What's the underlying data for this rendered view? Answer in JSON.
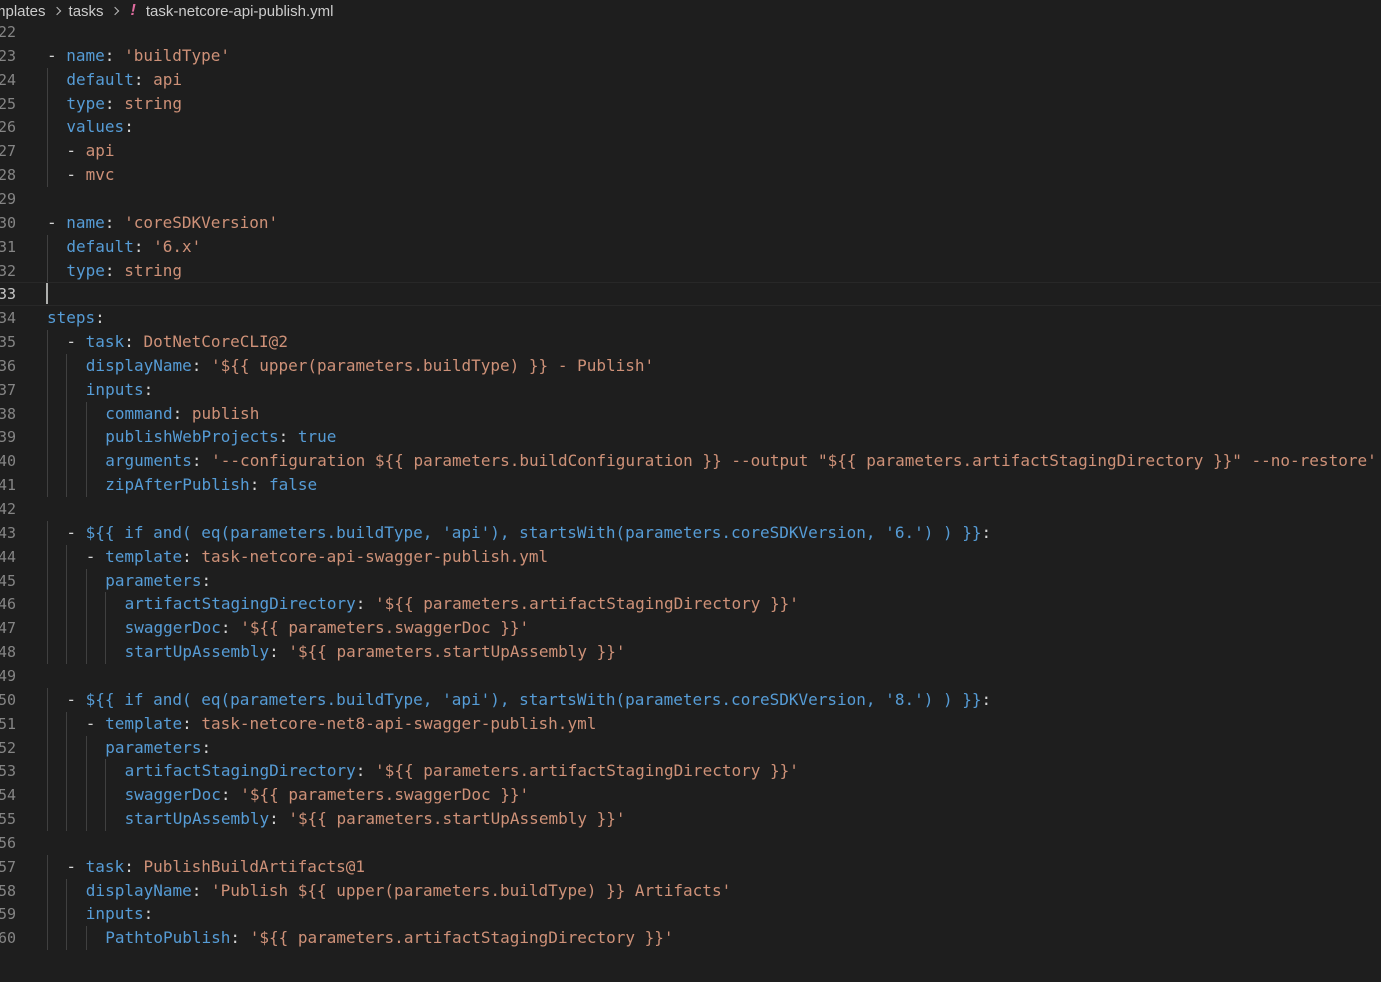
{
  "breadcrumb": {
    "parts": [
      "mplates",
      "tasks",
      "task-netcore-api-publish.yml"
    ],
    "file_icon": "!"
  },
  "editor": {
    "current_line": 33,
    "lines": [
      {
        "n": "22",
        "indent": 0,
        "tokens": []
      },
      {
        "n": "23",
        "indent": 0,
        "tokens": [
          [
            "p",
            "- "
          ],
          [
            "k",
            "name"
          ],
          [
            "p",
            ": "
          ],
          [
            "s",
            "'buildType'"
          ]
        ]
      },
      {
        "n": "24",
        "indent": 1,
        "tokens": [
          [
            "k",
            "default"
          ],
          [
            "p",
            ": "
          ],
          [
            "s",
            "api"
          ]
        ]
      },
      {
        "n": "25",
        "indent": 1,
        "tokens": [
          [
            "k",
            "type"
          ],
          [
            "p",
            ": "
          ],
          [
            "s",
            "string"
          ]
        ]
      },
      {
        "n": "26",
        "indent": 1,
        "tokens": [
          [
            "k",
            "values"
          ],
          [
            "p",
            ":"
          ]
        ]
      },
      {
        "n": "27",
        "indent": 1,
        "tokens": [
          [
            "p",
            "- "
          ],
          [
            "s",
            "api"
          ]
        ]
      },
      {
        "n": "28",
        "indent": 1,
        "tokens": [
          [
            "p",
            "- "
          ],
          [
            "s",
            "mvc"
          ]
        ]
      },
      {
        "n": "29",
        "indent": 0,
        "tokens": []
      },
      {
        "n": "30",
        "indent": 0,
        "tokens": [
          [
            "p",
            "- "
          ],
          [
            "k",
            "name"
          ],
          [
            "p",
            ": "
          ],
          [
            "s",
            "'coreSDKVersion'"
          ]
        ]
      },
      {
        "n": "31",
        "indent": 1,
        "tokens": [
          [
            "k",
            "default"
          ],
          [
            "p",
            ": "
          ],
          [
            "s",
            "'6.x'"
          ]
        ]
      },
      {
        "n": "32",
        "indent": 1,
        "tokens": [
          [
            "k",
            "type"
          ],
          [
            "p",
            ": "
          ],
          [
            "s",
            "string"
          ]
        ]
      },
      {
        "n": "33",
        "indent": 0,
        "tokens": []
      },
      {
        "n": "34",
        "indent": 0,
        "tokens": [
          [
            "k",
            "steps"
          ],
          [
            "p",
            ":"
          ]
        ]
      },
      {
        "n": "35",
        "indent": 1,
        "tokens": [
          [
            "p",
            "- "
          ],
          [
            "k",
            "task"
          ],
          [
            "p",
            ": "
          ],
          [
            "s",
            "DotNetCoreCLI@2"
          ]
        ]
      },
      {
        "n": "36",
        "indent": 2,
        "tokens": [
          [
            "k",
            "displayName"
          ],
          [
            "p",
            ": "
          ],
          [
            "s",
            "'${{ upper(parameters.buildType) }} - Publish'"
          ]
        ]
      },
      {
        "n": "37",
        "indent": 2,
        "tokens": [
          [
            "k",
            "inputs"
          ],
          [
            "p",
            ":"
          ]
        ]
      },
      {
        "n": "38",
        "indent": 3,
        "tokens": [
          [
            "k",
            "command"
          ],
          [
            "p",
            ": "
          ],
          [
            "s",
            "publish"
          ]
        ]
      },
      {
        "n": "39",
        "indent": 3,
        "tokens": [
          [
            "k",
            "publishWebProjects"
          ],
          [
            "p",
            ": "
          ],
          [
            "k",
            "true"
          ]
        ]
      },
      {
        "n": "40",
        "indent": 3,
        "tokens": [
          [
            "k",
            "arguments"
          ],
          [
            "p",
            ": "
          ],
          [
            "s",
            "'--configuration ${{ parameters.buildConfiguration }} --output \"${{ parameters.artifactStagingDirectory }}\" --no-restore'"
          ]
        ]
      },
      {
        "n": "41",
        "indent": 3,
        "tokens": [
          [
            "k",
            "zipAfterPublish"
          ],
          [
            "p",
            ": "
          ],
          [
            "k",
            "false"
          ]
        ]
      },
      {
        "n": "42",
        "indent": 0,
        "tokens": []
      },
      {
        "n": "43",
        "indent": 1,
        "tokens": [
          [
            "p",
            "- "
          ],
          [
            "k",
            "${{ if and( eq(parameters.buildType, 'api'), startsWith(parameters.coreSDKVersion, '6.') ) }}"
          ],
          [
            "p",
            ":"
          ]
        ]
      },
      {
        "n": "44",
        "indent": 2,
        "tokens": [
          [
            "p",
            "- "
          ],
          [
            "k",
            "template"
          ],
          [
            "p",
            ": "
          ],
          [
            "s",
            "task-netcore-api-swagger-publish.yml"
          ]
        ]
      },
      {
        "n": "45",
        "indent": 3,
        "tokens": [
          [
            "k",
            "parameters"
          ],
          [
            "p",
            ":"
          ]
        ]
      },
      {
        "n": "46",
        "indent": 4,
        "tokens": [
          [
            "k",
            "artifactStagingDirectory"
          ],
          [
            "p",
            ": "
          ],
          [
            "s",
            "'${{ parameters.artifactStagingDirectory }}'"
          ]
        ]
      },
      {
        "n": "47",
        "indent": 4,
        "tokens": [
          [
            "k",
            "swaggerDoc"
          ],
          [
            "p",
            ": "
          ],
          [
            "s",
            "'${{ parameters.swaggerDoc }}'"
          ]
        ]
      },
      {
        "n": "48",
        "indent": 4,
        "tokens": [
          [
            "k",
            "startUpAssembly"
          ],
          [
            "p",
            ": "
          ],
          [
            "s",
            "'${{ parameters.startUpAssembly }}'"
          ]
        ]
      },
      {
        "n": "49",
        "indent": 0,
        "tokens": []
      },
      {
        "n": "50",
        "indent": 1,
        "tokens": [
          [
            "p",
            "- "
          ],
          [
            "k",
            "${{ if and( eq(parameters.buildType, 'api'), startsWith(parameters.coreSDKVersion, '8.') ) }}"
          ],
          [
            "p",
            ":"
          ]
        ]
      },
      {
        "n": "51",
        "indent": 2,
        "tokens": [
          [
            "p",
            "- "
          ],
          [
            "k",
            "template"
          ],
          [
            "p",
            ": "
          ],
          [
            "s",
            "task-netcore-net8-api-swagger-publish.yml"
          ]
        ]
      },
      {
        "n": "52",
        "indent": 3,
        "tokens": [
          [
            "k",
            "parameters"
          ],
          [
            "p",
            ":"
          ]
        ]
      },
      {
        "n": "53",
        "indent": 4,
        "tokens": [
          [
            "k",
            "artifactStagingDirectory"
          ],
          [
            "p",
            ": "
          ],
          [
            "s",
            "'${{ parameters.artifactStagingDirectory }}'"
          ]
        ]
      },
      {
        "n": "54",
        "indent": 4,
        "tokens": [
          [
            "k",
            "swaggerDoc"
          ],
          [
            "p",
            ": "
          ],
          [
            "s",
            "'${{ parameters.swaggerDoc }}'"
          ]
        ]
      },
      {
        "n": "55",
        "indent": 4,
        "tokens": [
          [
            "k",
            "startUpAssembly"
          ],
          [
            "p",
            ": "
          ],
          [
            "s",
            "'${{ parameters.startUpAssembly }}'"
          ]
        ]
      },
      {
        "n": "56",
        "indent": 0,
        "tokens": []
      },
      {
        "n": "57",
        "indent": 1,
        "tokens": [
          [
            "p",
            "- "
          ],
          [
            "k",
            "task"
          ],
          [
            "p",
            ": "
          ],
          [
            "s",
            "PublishBuildArtifacts@1"
          ]
        ]
      },
      {
        "n": "58",
        "indent": 2,
        "tokens": [
          [
            "k",
            "displayName"
          ],
          [
            "p",
            ": "
          ],
          [
            "s",
            "'Publish ${{ upper(parameters.buildType) }} Artifacts'"
          ]
        ]
      },
      {
        "n": "59",
        "indent": 2,
        "tokens": [
          [
            "k",
            "inputs"
          ],
          [
            "p",
            ":"
          ]
        ]
      },
      {
        "n": "60",
        "indent": 3,
        "tokens": [
          [
            "k",
            "PathtoPublish"
          ],
          [
            "p",
            ": "
          ],
          [
            "s",
            "'${{ parameters.artifactStagingDirectory }}'"
          ]
        ]
      }
    ]
  },
  "colors": {
    "background": "#1e1e1e",
    "key": "#569cd6",
    "string": "#ce9178",
    "punctuation": "#d4d4d4",
    "line_number": "#858585"
  }
}
